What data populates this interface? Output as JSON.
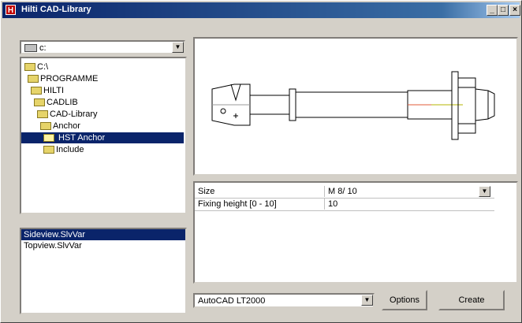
{
  "window": {
    "title": "Hilti CAD-Library",
    "app_icon_letter": "H"
  },
  "titlebar_buttons": {
    "minimize": "_",
    "maximize": "□",
    "close": "×"
  },
  "drive_select": {
    "value": "c:"
  },
  "tree": {
    "items": [
      {
        "label": "C:\\"
      },
      {
        "label": "PROGRAMME"
      },
      {
        "label": "HILTI"
      },
      {
        "label": "CADLIB"
      },
      {
        "label": "CAD-Library"
      },
      {
        "label": "Anchor"
      },
      {
        "label": "HST Anchor",
        "selected": true
      },
      {
        "label": "Include"
      }
    ]
  },
  "view_list": {
    "items": [
      {
        "label": "Sideview.SlvVar",
        "selected": true
      },
      {
        "label": "Topview.SlvVar"
      }
    ]
  },
  "properties": [
    {
      "label": "Size",
      "value": "M 8/ 10",
      "has_dropdown": true
    },
    {
      "label": "Fixing height [0 - 10]",
      "value": "10"
    }
  ],
  "cad_select": {
    "value": "AutoCAD LT2000"
  },
  "buttons": {
    "options": "Options",
    "create": "Create"
  },
  "colors": {
    "title_start": "#0a246a",
    "title_end": "#a6caf0",
    "selection": "#0a246a",
    "face": "#d4d0c8"
  }
}
